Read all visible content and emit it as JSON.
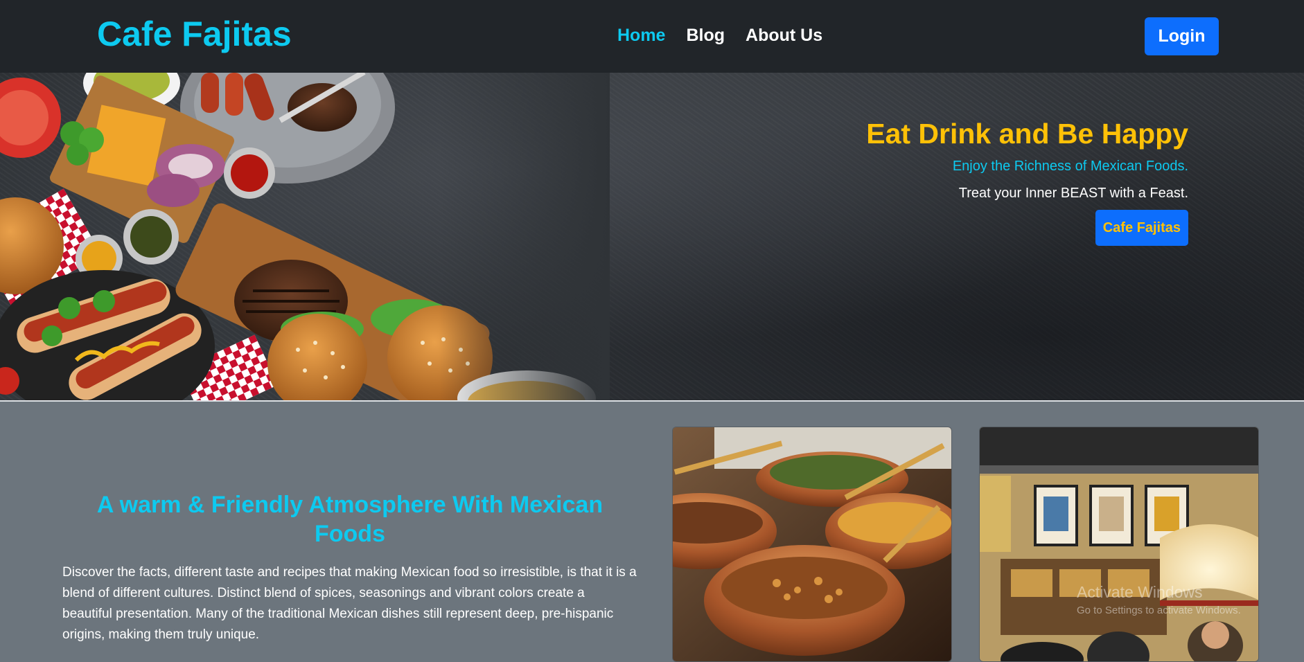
{
  "navbar": {
    "brand": "Cafe Fajitas",
    "links": [
      {
        "label": "Home",
        "active": true
      },
      {
        "label": "Blog",
        "active": false
      },
      {
        "label": "About Us",
        "active": false
      }
    ],
    "login_label": "Login"
  },
  "hero": {
    "title": "Eat Drink and Be Happy",
    "subtitle": "Enjoy the Richness of Mexican Foods.",
    "tagline": "Treat your Inner BEAST with a Feast.",
    "button_label": "Cafe Fajitas"
  },
  "about": {
    "title": "A warm & Friendly Atmosphere With Mexican Foods",
    "text": "Discover the facts, different taste and recipes that making Mexican food so irresistible, is that it is a blend of different cultures. Distinct blend of spices, seasonings and vibrant colors create a beautiful presentation. Many of the traditional Mexican dishes still represent deep, pre-hispanic origins, making them truly unique."
  },
  "watermark": {
    "line1": "Activate Windows",
    "line2": "Go to Settings to activate Windows."
  },
  "colors": {
    "navbar_bg": "#212529",
    "brand": "#0dcaf0",
    "primary": "#0d6efd",
    "warning": "#ffc107",
    "section_bg": "#6c757d"
  }
}
